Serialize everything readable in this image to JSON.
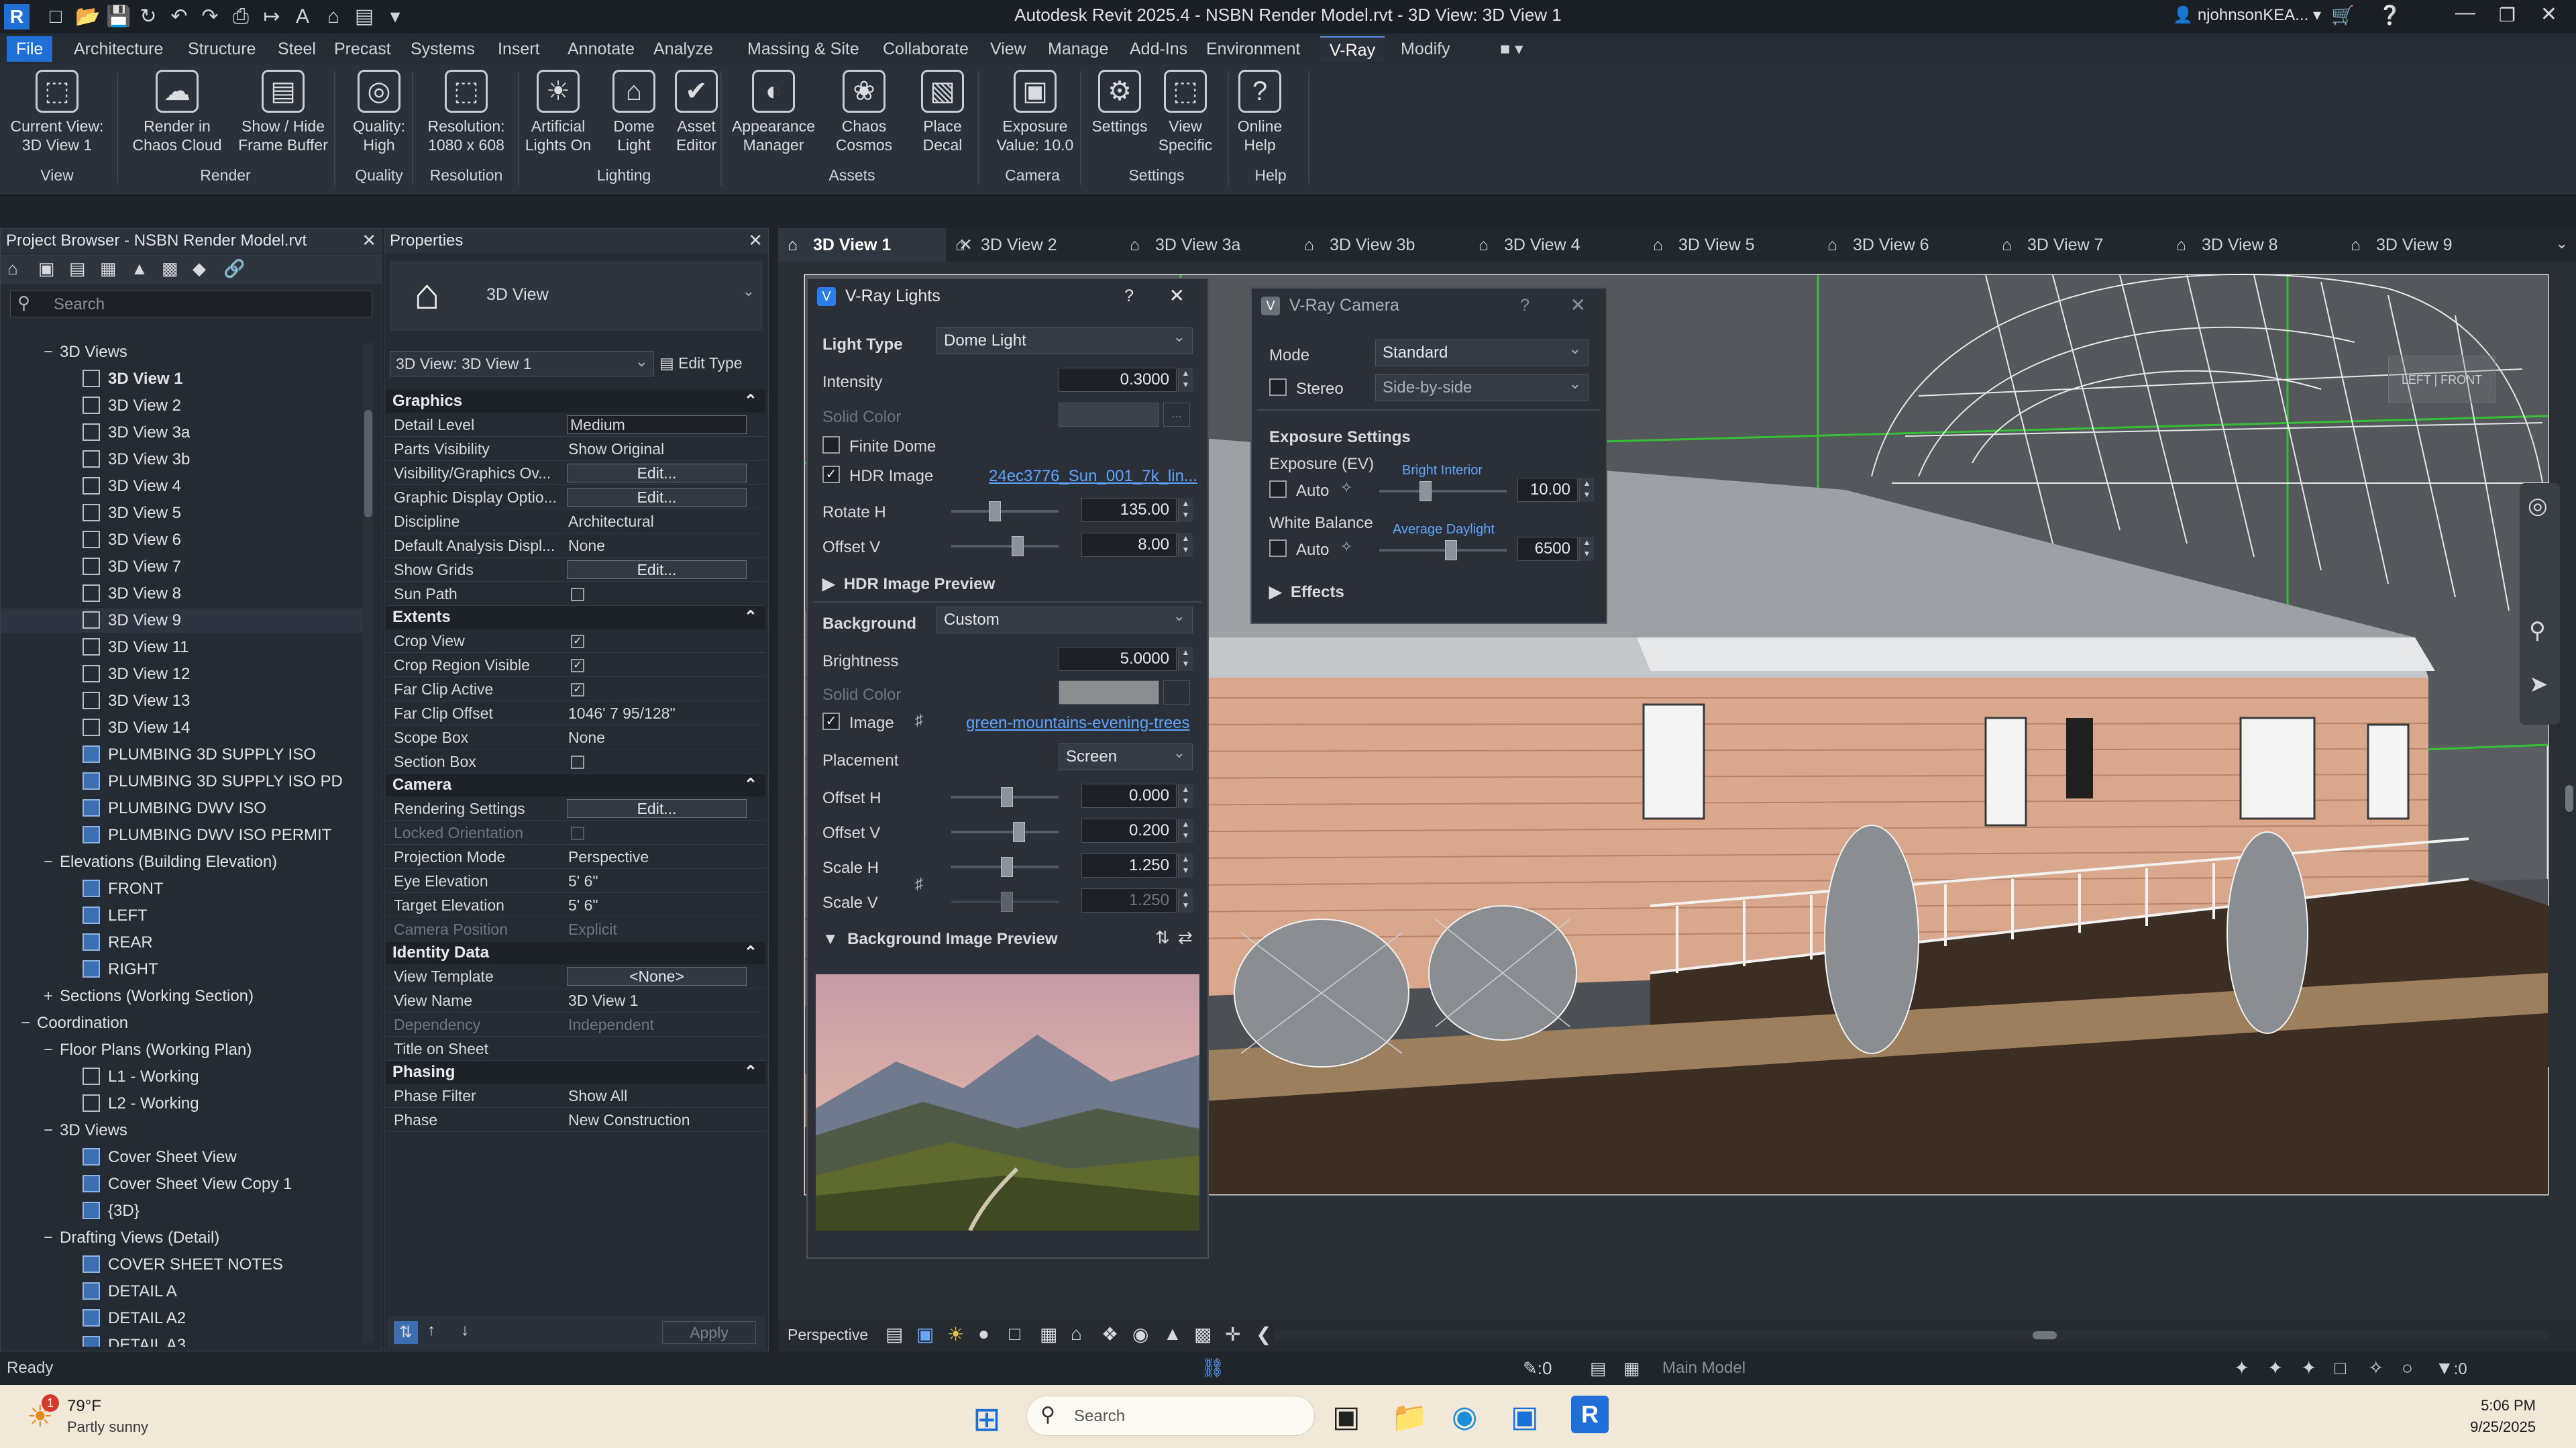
{
  "app": {
    "title": "Autodesk Revit 2025.4 - NSBN Render Model.rvt - 3D View: 3D View 1",
    "user": "njohnsonKEA...",
    "accent": "#2b7de9"
  },
  "menu_tabs": [
    "File",
    "Architecture",
    "Structure",
    "Steel",
    "Precast",
    "Systems",
    "Insert",
    "Annotate",
    "Analyze",
    "Massing & Site",
    "Collaborate",
    "View",
    "Manage",
    "Add-Ins",
    "Environment",
    "V-Ray",
    "Modify"
  ],
  "ribbon": {
    "buttons": [
      {
        "label1": "Current View:",
        "label2": "3D View 1",
        "icon": "cube-view-icon"
      },
      {
        "label1": "Render in",
        "label2": "Chaos Cloud",
        "icon": "cloud-render-icon"
      },
      {
        "label1": "Show / Hide",
        "label2": "Frame Buffer",
        "icon": "frame-buffer-icon"
      },
      {
        "label1": "Quality:",
        "label2": "High",
        "icon": "quality-icon"
      },
      {
        "label1": "Resolution:",
        "label2": "1080 x 608",
        "icon": "resolution-icon"
      },
      {
        "label1": "Artificial",
        "label2": "Lights On",
        "icon": "artificial-light-icon"
      },
      {
        "label1": "Dome",
        "label2": "Light",
        "icon": "dome-light-icon"
      },
      {
        "label1": "Asset",
        "label2": "Editor",
        "icon": "asset-editor-icon"
      },
      {
        "label1": "Appearance",
        "label2": "Manager",
        "icon": "appearance-manager-icon"
      },
      {
        "label1": "Chaos",
        "label2": "Cosmos",
        "icon": "chaos-cosmos-icon"
      },
      {
        "label1": "Place",
        "label2": "Decal",
        "icon": "place-decal-icon"
      },
      {
        "label1": "Exposure",
        "label2": "Value: 10.0",
        "icon": "exposure-icon"
      },
      {
        "label1": "Settings",
        "label2": "",
        "icon": "settings-gear-icon"
      },
      {
        "label1": "View",
        "label2": "Specific",
        "icon": "view-specific-icon"
      },
      {
        "label1": "Online",
        "label2": "Help",
        "icon": "help-icon"
      }
    ],
    "panels": [
      "View",
      "Render",
      "Quality",
      "Resolution",
      "Lighting",
      "Assets",
      "Camera",
      "Settings",
      "Help"
    ]
  },
  "project_browser": {
    "title": "Project Browser - NSBN Render Model.rvt",
    "search_placeholder": "Search",
    "rows": [
      {
        "label": "3D Views",
        "depth": 1,
        "toggle": "−",
        "icon": "none"
      },
      {
        "label": "3D View 1",
        "depth": 2,
        "toggle": "",
        "icon": "view",
        "bold": true
      },
      {
        "label": "3D View 2",
        "depth": 2,
        "toggle": "",
        "icon": "view"
      },
      {
        "label": "3D View 3a",
        "depth": 2,
        "toggle": "",
        "icon": "view"
      },
      {
        "label": "3D View 3b",
        "depth": 2,
        "toggle": "",
        "icon": "view"
      },
      {
        "label": "3D View 4",
        "depth": 2,
        "toggle": "",
        "icon": "view"
      },
      {
        "label": "3D View 5",
        "depth": 2,
        "toggle": "",
        "icon": "view"
      },
      {
        "label": "3D View 6",
        "depth": 2,
        "toggle": "",
        "icon": "view"
      },
      {
        "label": "3D View 7",
        "depth": 2,
        "toggle": "",
        "icon": "view"
      },
      {
        "label": "3D View 8",
        "depth": 2,
        "toggle": "",
        "icon": "view"
      },
      {
        "label": "3D View 9",
        "depth": 2,
        "toggle": "",
        "icon": "view",
        "hover": true
      },
      {
        "label": "3D View 11",
        "depth": 2,
        "toggle": "",
        "icon": "view"
      },
      {
        "label": "3D View 12",
        "depth": 2,
        "toggle": "",
        "icon": "view"
      },
      {
        "label": "3D View 13",
        "depth": 2,
        "toggle": "",
        "icon": "view"
      },
      {
        "label": "3D View 14",
        "depth": 2,
        "toggle": "",
        "icon": "view"
      },
      {
        "label": "PLUMBING 3D SUPPLY ISO",
        "depth": 2,
        "toggle": "",
        "icon": "blue"
      },
      {
        "label": "PLUMBING 3D SUPPLY ISO PD",
        "depth": 2,
        "toggle": "",
        "icon": "blue"
      },
      {
        "label": "PLUMBING DWV ISO",
        "depth": 2,
        "toggle": "",
        "icon": "blue"
      },
      {
        "label": "PLUMBING DWV ISO PERMIT",
        "depth": 2,
        "toggle": "",
        "icon": "blue"
      },
      {
        "label": "Elevations (Building Elevation)",
        "depth": 1,
        "toggle": "−",
        "icon": "none"
      },
      {
        "label": "FRONT",
        "depth": 2,
        "toggle": "",
        "icon": "blue"
      },
      {
        "label": "LEFT",
        "depth": 2,
        "toggle": "",
        "icon": "blue"
      },
      {
        "label": "REAR",
        "depth": 2,
        "toggle": "",
        "icon": "blue"
      },
      {
        "label": "RIGHT",
        "depth": 2,
        "toggle": "",
        "icon": "blue"
      },
      {
        "label": "Sections (Working Section)",
        "depth": 1,
        "toggle": "+",
        "icon": "none"
      },
      {
        "label": "Coordination",
        "depth": 0,
        "toggle": "−",
        "icon": "none"
      },
      {
        "label": "Floor Plans (Working Plan)",
        "depth": 1,
        "toggle": "−",
        "icon": "none"
      },
      {
        "label": "L1 - Working",
        "depth": 2,
        "toggle": "",
        "icon": "view"
      },
      {
        "label": "L2 - Working",
        "depth": 2,
        "toggle": "",
        "icon": "view"
      },
      {
        "label": "3D Views",
        "depth": 1,
        "toggle": "−",
        "icon": "none"
      },
      {
        "label": "Cover Sheet View",
        "depth": 2,
        "toggle": "",
        "icon": "blue"
      },
      {
        "label": "Cover Sheet View Copy 1",
        "depth": 2,
        "toggle": "",
        "icon": "blue"
      },
      {
        "label": "{3D}",
        "depth": 2,
        "toggle": "",
        "icon": "blue"
      },
      {
        "label": "Drafting Views (Detail)",
        "depth": 1,
        "toggle": "−",
        "icon": "none"
      },
      {
        "label": "COVER SHEET NOTES",
        "depth": 2,
        "toggle": "",
        "icon": "blue"
      },
      {
        "label": "DETAIL A",
        "depth": 2,
        "toggle": "",
        "icon": "blue"
      },
      {
        "label": "DETAIL A2",
        "depth": 2,
        "toggle": "",
        "icon": "blue"
      },
      {
        "label": "DETAIL A3",
        "depth": 2,
        "toggle": "",
        "icon": "blue"
      }
    ]
  },
  "properties": {
    "title": "Properties",
    "type_name": "3D View",
    "instance_selector": "3D View: 3D View 1",
    "edit_type": "Edit Type",
    "apply": "Apply",
    "sections": [
      {
        "name": "Graphics",
        "rows": [
          {
            "k": "Detail Level",
            "v": "Medium",
            "kind": "box"
          },
          {
            "k": "Parts Visibility",
            "v": "Show Original",
            "kind": "text"
          },
          {
            "k": "Visibility/Graphics Ov...",
            "v": "Edit...",
            "kind": "button"
          },
          {
            "k": "Graphic Display Optio...",
            "v": "Edit...",
            "kind": "button"
          },
          {
            "k": "Discipline",
            "v": "Architectural",
            "kind": "text"
          },
          {
            "k": "Default Analysis Displ...",
            "v": "None",
            "kind": "text"
          },
          {
            "k": "Show Grids",
            "v": "Edit...",
            "kind": "button"
          },
          {
            "k": "Sun Path",
            "v": "",
            "kind": "check",
            "checked": false
          }
        ]
      },
      {
        "name": "Extents",
        "rows": [
          {
            "k": "Crop View",
            "v": "",
            "kind": "check",
            "checked": true
          },
          {
            "k": "Crop Region Visible",
            "v": "",
            "kind": "check",
            "checked": true
          },
          {
            "k": "Far Clip Active",
            "v": "",
            "kind": "check",
            "checked": true
          },
          {
            "k": "Far Clip Offset",
            "v": "1046'  7 95/128\"",
            "kind": "text"
          },
          {
            "k": "Scope Box",
            "v": "None",
            "kind": "text"
          },
          {
            "k": "Section Box",
            "v": "",
            "kind": "check",
            "checked": false
          }
        ]
      },
      {
        "name": "Camera",
        "rows": [
          {
            "k": "Rendering Settings",
            "v": "Edit...",
            "kind": "button"
          },
          {
            "k": "Locked Orientation",
            "v": "",
            "kind": "check",
            "checked": false,
            "dim": true
          },
          {
            "k": "Projection Mode",
            "v": "Perspective",
            "kind": "text"
          },
          {
            "k": "Eye Elevation",
            "v": "5'  6\"",
            "kind": "text"
          },
          {
            "k": "Target Elevation",
            "v": "5'  6\"",
            "kind": "text"
          },
          {
            "k": "Camera Position",
            "v": "Explicit",
            "kind": "text",
            "dim": true
          }
        ]
      },
      {
        "name": "Identity Data",
        "rows": [
          {
            "k": "View Template",
            "v": "<None>",
            "kind": "button"
          },
          {
            "k": "View Name",
            "v": "3D View 1",
            "kind": "text"
          },
          {
            "k": "Dependency",
            "v": "Independent",
            "kind": "text",
            "dim": true
          },
          {
            "k": "Title on Sheet",
            "v": "",
            "kind": "text"
          }
        ]
      },
      {
        "name": "Phasing",
        "rows": [
          {
            "k": "Phase Filter",
            "v": "Show All",
            "kind": "text"
          },
          {
            "k": "Phase",
            "v": "New Construction",
            "kind": "text"
          }
        ]
      }
    ]
  },
  "view_tabs": [
    "3D View 1",
    "3D View 2",
    "3D View 3a",
    "3D View 3b",
    "3D View 4",
    "3D View 5",
    "3D View 6",
    "3D View 7",
    "3D View 8",
    "3D View 9"
  ],
  "vray_lights": {
    "title": "V-Ray Lights",
    "light_type_label": "Light Type",
    "light_type": "Dome Light",
    "intensity_label": "Intensity",
    "intensity": "0.3000",
    "solid_color_label": "Solid Color",
    "finite_dome_label": "Finite Dome",
    "hdr_image_label": "HDR Image",
    "hdr_file": "24ec3776_Sun_001_7k_lin...",
    "rotate_h_label": "Rotate H",
    "rotate_h": "135.00",
    "offset_v_label": "Offset V",
    "offset_v": "8.00",
    "hdr_preview_label": "HDR Image Preview",
    "background_label": "Background",
    "background": "Custom",
    "brightness_label": "Brightness",
    "brightness": "5.0000",
    "bg_solid_color_label": "Solid Color",
    "image_label": "Image",
    "image_file": "green-mountains-evening-trees",
    "placement_label": "Placement",
    "placement": "Screen",
    "bg_offset_h_label": "Offset H",
    "bg_offset_h": "0.000",
    "bg_offset_v_label": "Offset V",
    "bg_offset_v": "0.200",
    "scale_h_label": "Scale H",
    "scale_h": "1.250",
    "scale_v_label": "Scale V",
    "scale_v": "1.250",
    "bg_preview_label": "Background Image Preview"
  },
  "vray_camera": {
    "title": "V-Ray Camera",
    "mode_label": "Mode",
    "mode": "Standard",
    "stereo_label": "Stereo",
    "stereo_mode": "Side-by-side",
    "exposure_settings_label": "Exposure Settings",
    "exposure_label": "Exposure (EV)",
    "exposure_auto_label": "Auto",
    "exposure_hint": "Bright Interior",
    "exposure_value": "10.00",
    "white_balance_label": "White Balance",
    "wb_auto_label": "Auto",
    "wb_hint": "Average Daylight",
    "wb_value": "6500",
    "effects_label": "Effects"
  },
  "view_control": {
    "projection": "Perspective"
  },
  "status": {
    "text": "Ready",
    "model": "Main Model",
    "filter_count": ":0"
  },
  "taskbar": {
    "weather_temp": "79°F",
    "weather_desc": "Partly sunny",
    "weather_badge": "1",
    "search_placeholder": "Search",
    "time": "5:06 PM",
    "date": "9/25/2025"
  }
}
